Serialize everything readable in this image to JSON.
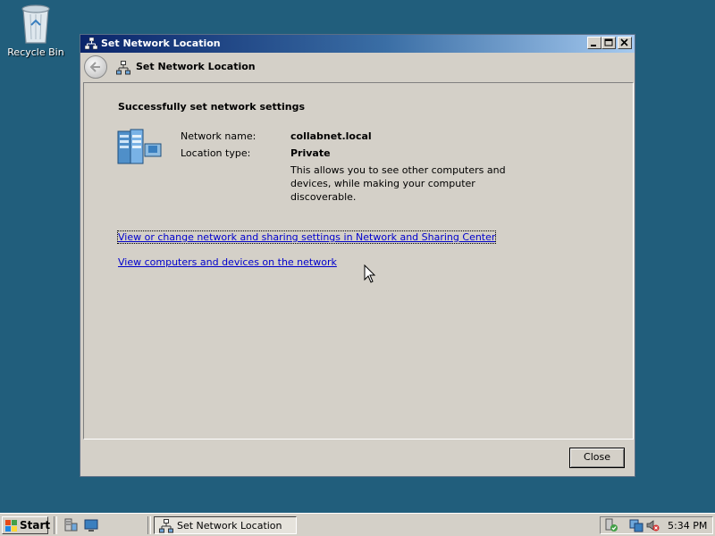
{
  "desktop": {
    "recycle_bin_label": "Recycle Bin"
  },
  "window": {
    "title": "Set Network Location",
    "nav_title": "Set Network Location",
    "heading": "Successfully set network settings",
    "network_name_label": "Network name:",
    "network_name_value": "collabnet.local",
    "location_type_label": "Location type:",
    "location_type_value": "Private",
    "description": "This allows you to see other computers and devices, while making your computer discoverable.",
    "link_sharing_center": "View or change network and sharing settings in Network and Sharing Center",
    "link_view_devices": "View computers and devices on the network",
    "close_label": "Close"
  },
  "taskbar": {
    "start_label": "Start",
    "task_label": "Set Network Location",
    "clock": "5:34 PM"
  },
  "icons": {
    "recycle_bin": "recycle-bin-icon",
    "network": "network-icon",
    "back": "back-arrow-icon",
    "server_manager": "server-manager-icon",
    "show_desktop": "show-desktop-icon"
  },
  "colors": {
    "desktop_bg": "#215e7c",
    "title_gradient_start": "#0a246a",
    "title_gradient_end": "#a6caf0",
    "link": "#0000cc",
    "window_bg": "#d4d0c8"
  }
}
